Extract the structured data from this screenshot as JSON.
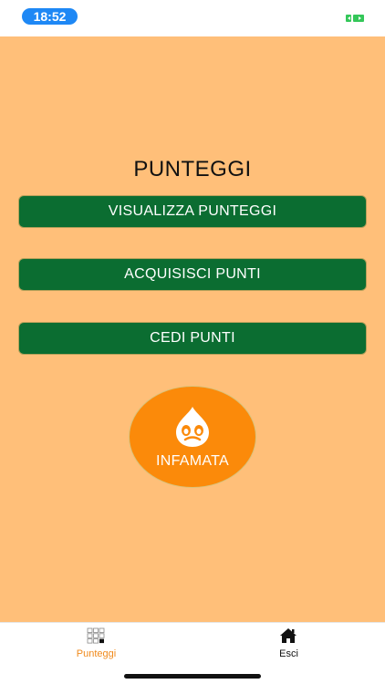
{
  "status_bar": {
    "time": "18:52",
    "time_pill_color": "#1e88f5",
    "right_icon": "battery-icon"
  },
  "main": {
    "background": "#ffbf79",
    "title": "PUNTEGGI",
    "buttons": [
      {
        "label": "VISUALIZZA PUNTEGGI"
      },
      {
        "label": "ACQUISISCI PUNTI"
      },
      {
        "label": "CEDI PUNTI"
      }
    ],
    "button_color": "#0b6d31",
    "circle_button": {
      "label": "INFAMATA",
      "icon": "drupal-drop-icon",
      "color": "#fb8a0a"
    }
  },
  "tab_bar": {
    "tabs": [
      {
        "label": "Punteggi",
        "icon": "grid-icon",
        "active": true
      },
      {
        "label": "Esci",
        "icon": "home-icon",
        "active": false
      }
    ],
    "active_color": "#f08a1c"
  }
}
